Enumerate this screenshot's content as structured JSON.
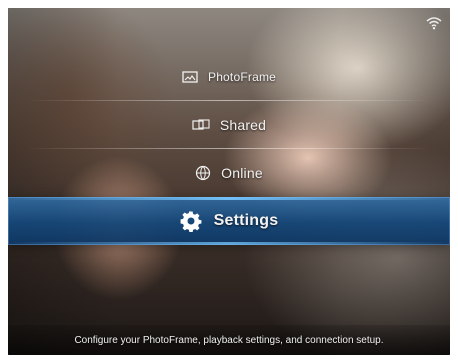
{
  "menu": {
    "items": [
      {
        "label": "PhotoFrame",
        "icon": "photo-frame-icon"
      },
      {
        "label": "Shared",
        "icon": "shared-icon"
      },
      {
        "label": "Online",
        "icon": "globe-icon"
      },
      {
        "label": "Settings",
        "icon": "gear-icon"
      }
    ],
    "selected_index": 3
  },
  "footer": {
    "description": "Configure your PhotoFrame, playback settings, and connection setup."
  },
  "status": {
    "wifi_icon": "wifi-icon"
  },
  "colors": {
    "selection": "#1f5f96",
    "text": "#f2f2f2"
  }
}
